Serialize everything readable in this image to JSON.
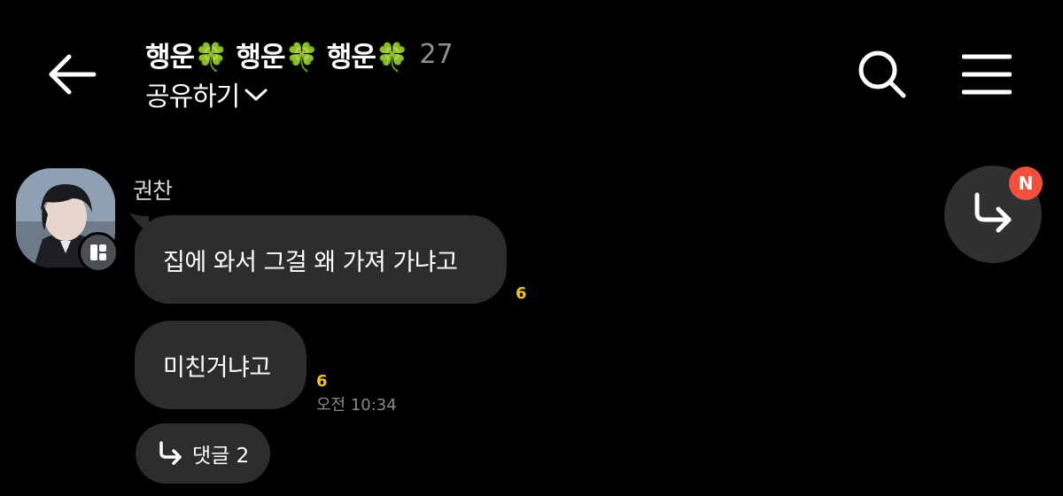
{
  "header": {
    "title": "행운🍀 행운🍀 행운🍀",
    "member_count": "27",
    "subtitle": "공유하기",
    "icons": {
      "back": "arrow-left-icon",
      "search": "search-icon",
      "menu": "hamburger-menu-icon",
      "subtitle_chevron": "chevron-down-icon"
    }
  },
  "messages": {
    "sender_name": "권찬",
    "items": [
      {
        "text": "집에 와서 그걸 왜 가져 가냐고",
        "unread": "6"
      },
      {
        "text": "미친거냐고",
        "unread": "6",
        "time": "오전 10:34"
      }
    ],
    "reply": {
      "label": "댓글 2",
      "icon": "reply-arrow-icon"
    }
  },
  "floating": {
    "icon": "reply-arrow-icon",
    "badge": "N"
  },
  "colors": {
    "background": "#000000",
    "bubble": "#2c2c2c",
    "unread": "#f2c22e",
    "badge": "#f0503c",
    "muted": "#8e8e8e"
  }
}
